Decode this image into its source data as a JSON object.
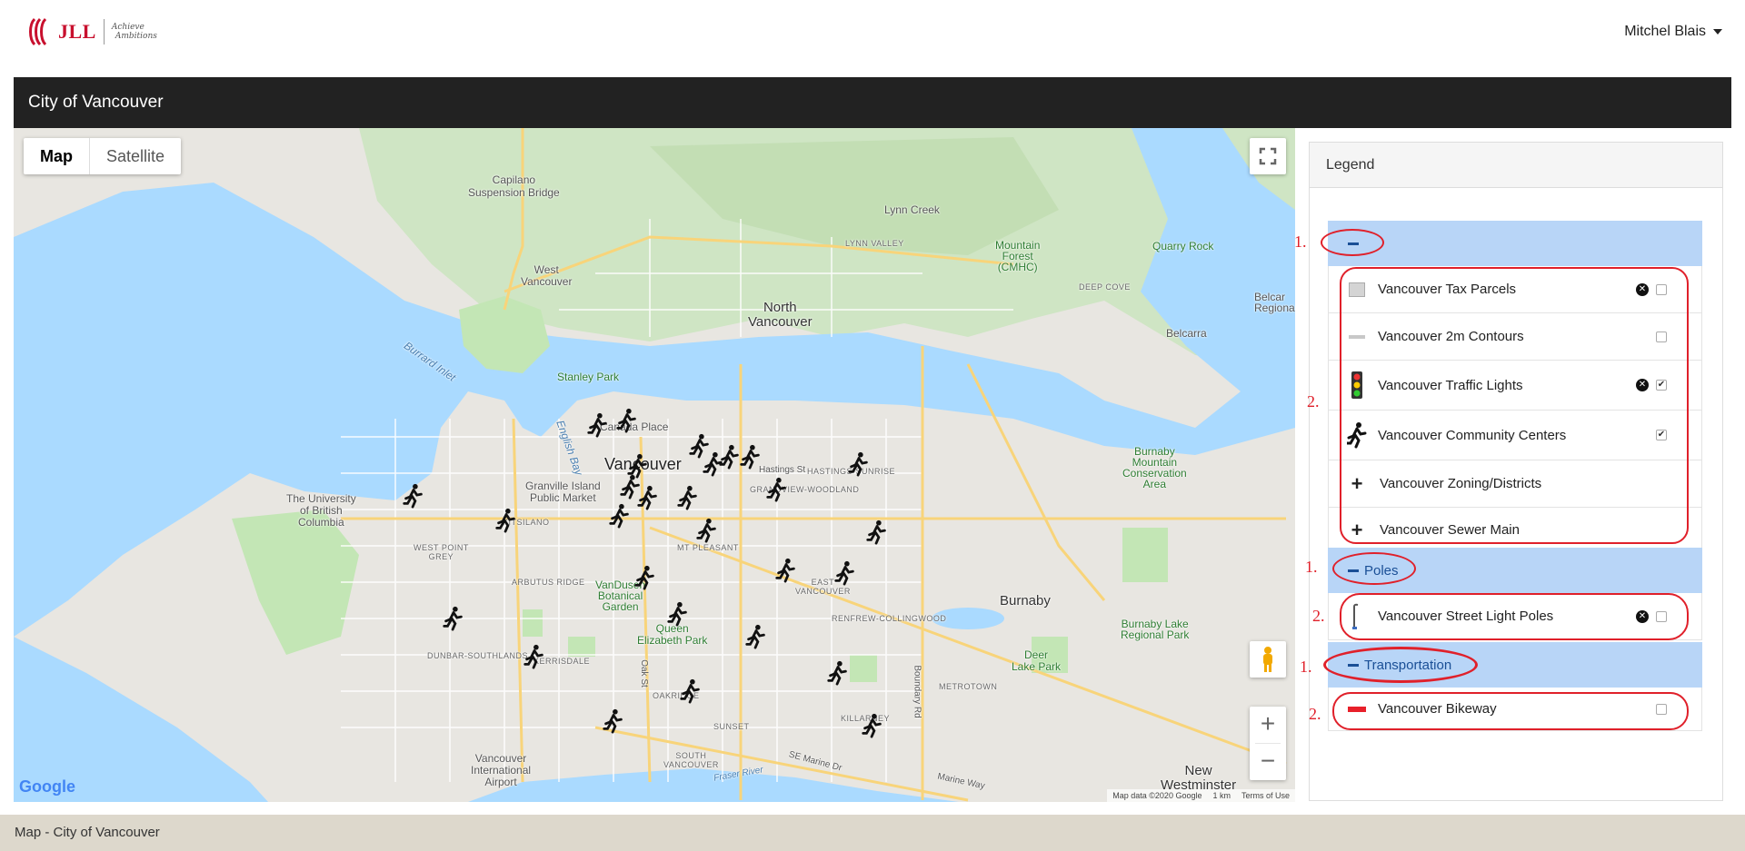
{
  "header": {
    "logo_text": "JLL",
    "logo_tagline_1": "Achieve",
    "logo_tagline_2": "Ambitions",
    "user_name": "Mitchel Blais"
  },
  "page_title": "City of Vancouver",
  "map": {
    "type_options": [
      "Map",
      "Satellite"
    ],
    "selected_type": "Map",
    "zoom_in": "+",
    "zoom_out": "−",
    "google_logo": "Google",
    "attribution": {
      "map_data": "Map data ©2020 Google",
      "scale": "1 km",
      "terms": "Terms of Use"
    },
    "labels": {
      "capilano": "Capilano\nSuspension Bridge",
      "lynn_creek": "Lynn Creek",
      "lynn_valley": "LYNN VALLEY",
      "mountain_forest": "Mountain\nForest\n(CMHC)",
      "quarry_rock": "Quarry Rock",
      "deep_cove": "DEEP COVE",
      "west_vancouver": "West\nVancouver",
      "north_vancouver": "North\nVancouver",
      "burrard_inlet": "Burrard Inlet",
      "stanley_park": "Stanley Park",
      "canada_place": "Canada Place",
      "english_bay": "English Bay",
      "vancouver": "Vancouver",
      "hastings_st": "Hastings St",
      "hastings_sunrise": "HASTINGS-SUNRISE",
      "grandview": "GRANDVIEW-WOODLAND",
      "granville_island": "Granville Island\nPublic Market",
      "ubc": "The University\nof British\nColumbia",
      "kitsilano": "KITSILANO",
      "west_point_grey": "WEST POINT\nGREY",
      "mt_pleasant": "MT PLEASANT",
      "arbutus_ridge": "ARBUTUS RIDGE",
      "vandusen": "VanDusen\nBotanical\nGarden",
      "east_vancouver": "EAST\nVANCOUVER",
      "renfrew": "RENFREW-COLLINGWOOD",
      "burnaby": "Burnaby",
      "burnaby_mountain": "Burnaby\nMountain\nConservation\nArea",
      "belcarra": "Belcarra",
      "belcarra_regional": "Belcar\nRegiona",
      "queen_elizabeth": "Queen\nElizabeth Park",
      "dunbar": "DUNBAR-SOUTHLANDS",
      "kerrisdale": "KERRISDALE",
      "oakridge": "OAKRIDGE",
      "sunset": "SUNSET",
      "killarney": "KILLARNEY",
      "south_vancouver": "SOUTH\nVANCOUVER",
      "burnaby_lake": "Burnaby Lake\nRegional Park",
      "deer_lake": "Deer\nLake Park",
      "metrotown": "METROTOWN",
      "airport": "Vancouver\nInternational\nAirport",
      "new_westminster": "New\nWestminster",
      "fraser_river": "Fraser River",
      "se_marine": "SE Marine Dr",
      "marine_way": "Marine Way",
      "oak_st": "Oak St",
      "boundary_rd": "Boundary Rd"
    }
  },
  "legend": {
    "title": "Legend",
    "groups": [
      {
        "name": "",
        "layers": [
          {
            "label": "Vancouver Tax Parcels",
            "symbol": "grey-square-icon",
            "removable": true,
            "checked": false
          },
          {
            "label": "Vancouver 2m Contours",
            "symbol": "grey-line-icon",
            "removable": false,
            "checked": false
          },
          {
            "label": "Vancouver Traffic Lights",
            "symbol": "traffic-light-icon",
            "removable": true,
            "checked": true
          },
          {
            "label": "Vancouver Community Centers",
            "symbol": "runner-icon",
            "removable": false,
            "checked": true
          },
          {
            "label": "Vancouver Zoning/Districts",
            "symbol": "plus-icon",
            "removable": false,
            "checked": null
          },
          {
            "label": "Vancouver Sewer Main",
            "symbol": "plus-icon",
            "removable": false,
            "checked": null
          }
        ]
      },
      {
        "name": "Poles",
        "layers": [
          {
            "label": "Vancouver Street Light Poles",
            "symbol": "street-light-icon",
            "removable": true,
            "checked": false
          }
        ]
      },
      {
        "name": "Transportation",
        "layers": [
          {
            "label": "Vancouver Bikeway",
            "symbol": "red-line-icon",
            "removable": false,
            "checked": false
          }
        ]
      }
    ]
  },
  "annotations": {
    "n1": "1.",
    "n2": "2."
  },
  "footer_text": "Map - City of Vancouver",
  "colors": {
    "water": "#aadaff",
    "land": "#e8e6e1",
    "park": "#c3e6b5",
    "road_major": "#f8d47a",
    "group_header": "#b8d5f7",
    "annotation": "#e0202a",
    "footer": "#ddd8cc"
  }
}
